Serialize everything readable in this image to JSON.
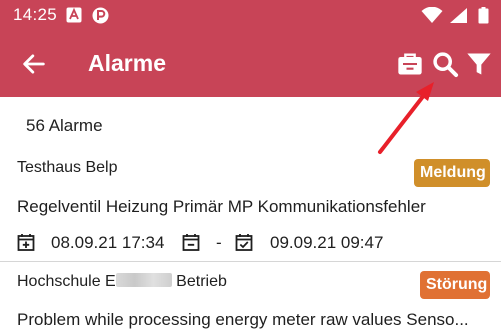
{
  "status_bar": {
    "time": "14:25",
    "icons": [
      "a-notification-icon",
      "p-app-icon",
      "wifi-icon",
      "signal-icon",
      "battery-icon"
    ]
  },
  "app_bar": {
    "title": "Alarme",
    "color": "#c84457",
    "actions": [
      "briefcase-icon",
      "search-icon",
      "filter-icon"
    ]
  },
  "list": {
    "count_label": "56 Alarme",
    "items": [
      {
        "place": "Testhaus Belp",
        "badge": "Meldung",
        "badge_color": "#d08f2a",
        "message": "Regelventil Heizung Primär MP Kommunikationsfehler",
        "start": "08.09.21 17:34",
        "separator": "-",
        "end": "09.09.21 09:47"
      },
      {
        "place_prefix": "Hochschule E",
        "place_suffix": "Betrieb",
        "badge": "Störung",
        "badge_color": "#e07134",
        "message": "Problem while processing energy meter raw values Senso..."
      }
    ]
  },
  "annotation": {
    "arrow_color": "#e8202a"
  }
}
